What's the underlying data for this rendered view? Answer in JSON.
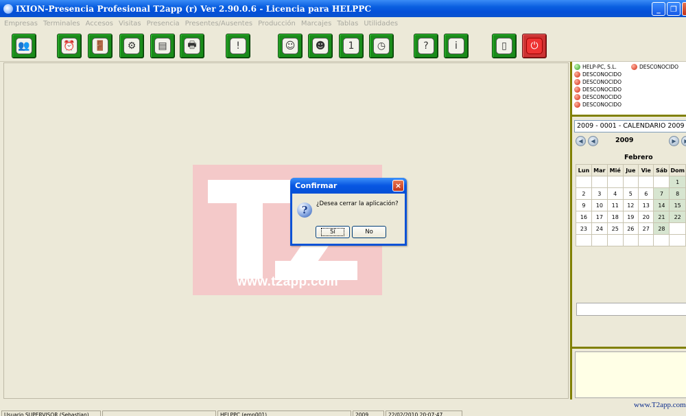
{
  "window": {
    "title": "IXION-Presencia Profesional T2app (r) Ver 2.90.0.6  -  Licencia para HELPPC",
    "minimize": "_",
    "maximize": "❐",
    "close": "×"
  },
  "menu": [
    "Empresas",
    "Terminales",
    "Accesos",
    "Visitas",
    "Presencia",
    "Presentes/Ausentes",
    "Producción",
    "Marcajes",
    "Tablas",
    "Utilidades"
  ],
  "toolbar": {
    "buttons": [
      {
        "icon": "users-icon",
        "glyph": "👥"
      },
      {
        "icon": "alarm-icon",
        "glyph": "⏰"
      },
      {
        "icon": "door-icon",
        "glyph": "🚪"
      },
      {
        "icon": "settings-icon",
        "glyph": "⚙"
      },
      {
        "icon": "terminal-icon",
        "glyph": "▤"
      },
      {
        "icon": "printer-icon",
        "glyph": "🖶"
      },
      {
        "icon": "info-circle-icon",
        "glyph": "!"
      },
      {
        "icon": "person-card-icon",
        "glyph": "☺"
      },
      {
        "icon": "employee-icon",
        "glyph": "☻"
      },
      {
        "icon": "calendar-icon",
        "glyph": "1"
      },
      {
        "icon": "clock-icon",
        "glyph": "◷"
      },
      {
        "icon": "help-icon",
        "glyph": "?"
      },
      {
        "icon": "about-icon",
        "glyph": "i"
      },
      {
        "icon": "document-icon",
        "glyph": "▯"
      },
      {
        "icon": "power-icon",
        "glyph": "⏻"
      }
    ]
  },
  "logo": {
    "url_text": "www.t2app.com"
  },
  "dialog": {
    "title": "Confirmar",
    "close": "×",
    "icon": "?",
    "message": "¿Desea cerrar la aplicación?",
    "yes_label": "Sí",
    "no_label": "No"
  },
  "terminals": [
    {
      "name": "HELP-PC, S.L.",
      "status": "green"
    },
    {
      "name": "DESCONOCIDO",
      "status": "red"
    },
    {
      "name": "DESCONOCIDO",
      "status": "red"
    },
    {
      "name": "DESCONOCIDO",
      "status": "red"
    },
    {
      "name": "DESCONOCIDO",
      "status": "red"
    },
    {
      "name": "DESCONOCIDO",
      "status": "red"
    },
    {
      "name": "DESCONOCIDO",
      "status": "red"
    }
  ],
  "calendar": {
    "selected": "2009 - 0001 - CALENDARIO 2009",
    "year": "2009",
    "month": "Febrero",
    "nav_prev": "◀",
    "nav_next": "▶",
    "weekdays": [
      "Lun",
      "Mar",
      "Mié",
      "Jue",
      "Vie",
      "Sáb",
      "Dom"
    ],
    "weeks": [
      [
        "",
        "",
        "",
        "",
        "",
        "",
        "1"
      ],
      [
        "2",
        "3",
        "4",
        "5",
        "6",
        "7",
        "8"
      ],
      [
        "9",
        "10",
        "11",
        "12",
        "13",
        "14",
        "15"
      ],
      [
        "16",
        "17",
        "18",
        "19",
        "20",
        "21",
        "22"
      ],
      [
        "23",
        "24",
        "25",
        "26",
        "27",
        "28",
        ""
      ],
      [
        "",
        "",
        "",
        "",
        "",
        "",
        ""
      ]
    ]
  },
  "footer": {
    "weblink": "www.T2app.com"
  },
  "status": {
    "user": "Usuario SUPERVISOR (Sebastian)",
    "empty1": "",
    "machine": "HELPPC  (emp001)",
    "year": "2009",
    "datetime": "22/02/2010  20:07:47"
  }
}
